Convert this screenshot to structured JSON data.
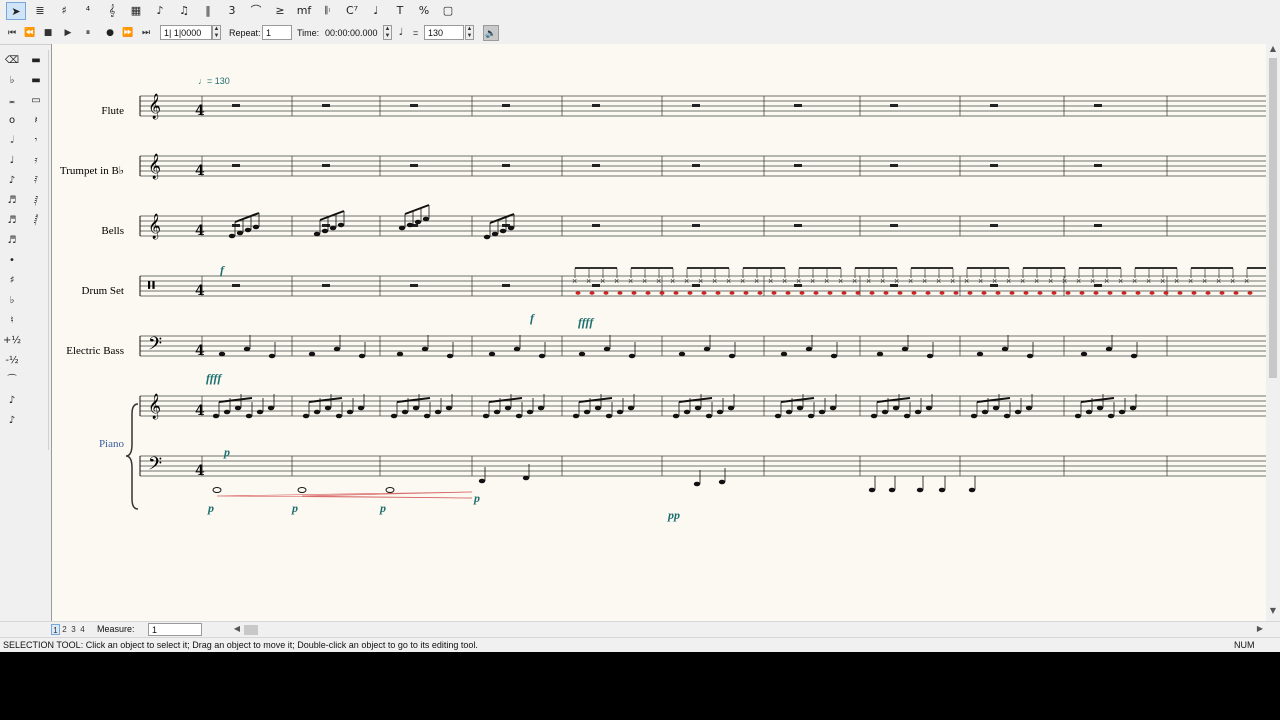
{
  "toolbar": {
    "tools": [
      {
        "name": "selection-tool",
        "glyph": "➤",
        "active": true
      },
      {
        "name": "staff-tool",
        "glyph": "≣"
      },
      {
        "name": "key-signature-tool",
        "glyph": "♯"
      },
      {
        "name": "time-signature-tool",
        "glyph": "⁴"
      },
      {
        "name": "clef-tool",
        "glyph": "𝄞"
      },
      {
        "name": "measure-tool",
        "glyph": "▦"
      },
      {
        "name": "simple-entry-tool",
        "glyph": "♪"
      },
      {
        "name": "speedy-entry-tool",
        "glyph": "♫"
      },
      {
        "name": "hyperscribe-tool",
        "glyph": "‖"
      },
      {
        "name": "tuplet-tool",
        "glyph": "3"
      },
      {
        "name": "smart-shape-tool",
        "glyph": "⌒"
      },
      {
        "name": "articulation-tool",
        "glyph": "≥"
      },
      {
        "name": "expression-tool",
        "glyph": "mf"
      },
      {
        "name": "repeat-tool",
        "glyph": "𝄆"
      },
      {
        "name": "chord-tool",
        "glyph": "C⁷"
      },
      {
        "name": "lyrics-tool",
        "glyph": "♩"
      },
      {
        "name": "text-tool",
        "glyph": "T"
      },
      {
        "name": "resize-tool",
        "glyph": "%"
      },
      {
        "name": "page-layout-tool",
        "glyph": "▢"
      }
    ]
  },
  "playback": {
    "counter": "1| 1|0000",
    "repeat_label": "Repeat:",
    "repeat_value": "1",
    "time_label": "Time:",
    "time_value": "00:00:00.000",
    "equals": "=",
    "tempo_value": "130"
  },
  "palette": {
    "left": [
      "eraser-icon",
      "double-flat-icon",
      "double-whole-note-icon",
      "whole-note-icon",
      "half-note-icon",
      "quarter-note-icon",
      "eighth-note-icon",
      "sixteenth-note-icon",
      "thirtysecond-note-icon",
      "sixtyfourth-note-icon",
      "dot-icon",
      "sharp-icon",
      "flat-icon",
      "natural-icon",
      "plus-half-icon",
      "minus-half-icon",
      "tie-icon",
      "grace-icon",
      "tuplet-small-icon"
    ],
    "right": [
      "double-rest-icon",
      "whole-rest-icon",
      "half-rest-icon",
      "quarter-rest-icon",
      "eighth-rest-icon",
      "sixteenth-rest-icon",
      "thirtysecond-rest-icon",
      "sixtyfourth-rest-icon",
      "onetwentyeighth-rest-icon"
    ]
  },
  "score": {
    "tempo_marking": "♩= 130",
    "instruments": [
      "Flute",
      "Trumpet in B♭",
      "Bells",
      "Drum Set",
      "Electric Bass",
      "Piano"
    ],
    "dynamics": [
      {
        "id": "bells-dyn",
        "text": "f"
      },
      {
        "id": "drum-dyn-1",
        "text": "f"
      },
      {
        "id": "drum-dyn-2",
        "text": "ffff"
      },
      {
        "id": "bass-dyn",
        "text": "ffff"
      },
      {
        "id": "piano-dyn",
        "text": "p"
      },
      {
        "id": "piano-lh-dyn-1",
        "text": "p"
      },
      {
        "id": "piano-lh-dyn-2",
        "text": "p"
      },
      {
        "id": "piano-lh-dyn-3",
        "text": "p"
      },
      {
        "id": "piano-lh-dyn-4",
        "text": "p"
      },
      {
        "id": "piano-lh-dyn-5",
        "text": "pp"
      }
    ],
    "colors": {
      "notes": "#111111",
      "dynamics": "#1f6f6f",
      "drum_red": "#cc2222",
      "piano_label": "#3a5fa0"
    }
  },
  "pages": [
    "1",
    "2",
    "3",
    "4"
  ],
  "measure_label": "Measure:",
  "measure_value": "1",
  "status": {
    "text": "SELECTION TOOL: Click an object to select it; Drag an object to move it; Double-click an object to go to its editing tool.",
    "num": "NUM"
  }
}
